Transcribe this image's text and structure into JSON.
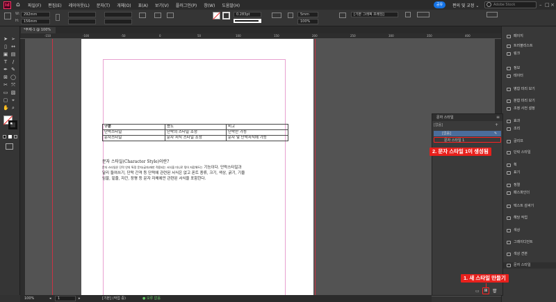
{
  "menubar": {
    "logo": "Id",
    "menu_items": [
      "파일(F)",
      "편집(E)",
      "레이아웃(L)",
      "문자(T)",
      "개체(O)",
      "표(A)",
      "보기(V)",
      "플러그인(P)",
      "창(W)",
      "도움말(H)"
    ],
    "share_label": "공유",
    "workspace_label": "편의 및 교정 ⌄",
    "search_placeholder": "Adobe Stock"
  },
  "controlbar": {
    "width_value": "292mm",
    "height_value": "156mm",
    "stroke_weight": "0.283pt",
    "offset_value": "5mm",
    "percent_value": "100%",
    "frame_style": "[기본 그래픽 프레임]"
  },
  "document": {
    "tab_label": "*주제-1 @ 100%"
  },
  "ruler_numbers": [
    "-150",
    "-100",
    "-50",
    "0",
    "50",
    "100",
    "150",
    "200",
    "250",
    "300",
    "350",
    "400"
  ],
  "table": {
    "rows": [
      [
        "구분",
        "용도",
        "비고"
      ],
      [
        "단락스타일",
        "단락의 스타일 조정",
        "단락만 가능"
      ],
      [
        "문자스타일",
        "문자 서식 스타일 조정",
        "문자 및 단락서식에 가능"
      ]
    ]
  },
  "body_text": {
    "heading": "문자 스타일(Character Style)이란?",
    "line1_small": "문자 스타일은 단락 안의 특정 문자(글자)에만 적용되는 서식을 미니로 묶어 저장해두는",
    "line1_large": " 기능이다. 단락스타일과",
    "line2": "달리 들여쓰기, 단락 간격 등 단락에 관련된 서식은 없고 폰트 종류, 크기, 색상, 굵기, 기울",
    "line3": "임꼴, 밑줄, 자간, 장평 등 문자 자체에만 관련된 서식을 포함한다."
  },
  "right_panel": {
    "items": [
      {
        "label": "페이지",
        "icon": "pages-icon"
      },
      {
        "label": "트러블리스트",
        "icon": "list-icon"
      },
      {
        "label": "링크",
        "icon": "link-icon"
      },
      {
        "label": "정보",
        "icon": "info-icon"
      },
      {
        "label": "테이터",
        "icon": "data-icon"
      },
      {
        "label": "병합 미리 보기",
        "icon": "preview-icon"
      },
      {
        "label": "분합 미리 보기",
        "icon": "separations-icon"
      },
      {
        "label": "조정 사전 설정",
        "icon": "preset-icon"
      },
      {
        "label": "효과",
        "icon": "effects-icon"
      },
      {
        "label": "조리",
        "icon": "glyph-icon"
      },
      {
        "label": "글리프",
        "icon": "glyphs-icon"
      },
      {
        "label": "단락 스타일",
        "icon": "paragraph-style-icon"
      },
      {
        "label": "획",
        "icon": "stroke-icon"
      },
      {
        "label": "표기",
        "icon": "notation-icon"
      },
      {
        "label": "정렬",
        "icon": "align-icon"
      },
      {
        "label": "패스파인더",
        "icon": "pathfinder-icon"
      },
      {
        "label": "텍스트 감싸기",
        "icon": "text-wrap-icon"
      },
      {
        "label": "해당 작업",
        "icon": "task-icon"
      },
      {
        "label": "색상",
        "icon": "color-icon"
      },
      {
        "label": "그레이디언트",
        "icon": "gradient-icon"
      },
      {
        "label": "색상 견본",
        "icon": "swatches-icon"
      },
      {
        "label": "문자 스타일",
        "icon": "character-style-icon"
      }
    ]
  },
  "char_style_panel": {
    "title": "문자 스타일",
    "header_row": "[없음]",
    "rows": [
      "[없음]",
      "문자 스타일 1"
    ]
  },
  "callouts": {
    "step1": "1. 새 스타일 만들기",
    "step2": "2. 문자 스타일 1이 생성됨"
  },
  "statusbar": {
    "zoom": "100%",
    "page": "1",
    "master": "[기본] (작업 중)",
    "errors": "● 오류 없음"
  },
  "colors": {
    "callout_red": "#e8201c",
    "highlight_blue": "#4b6d9b",
    "page_white": "#ffffff",
    "app_dark": "#323232"
  }
}
